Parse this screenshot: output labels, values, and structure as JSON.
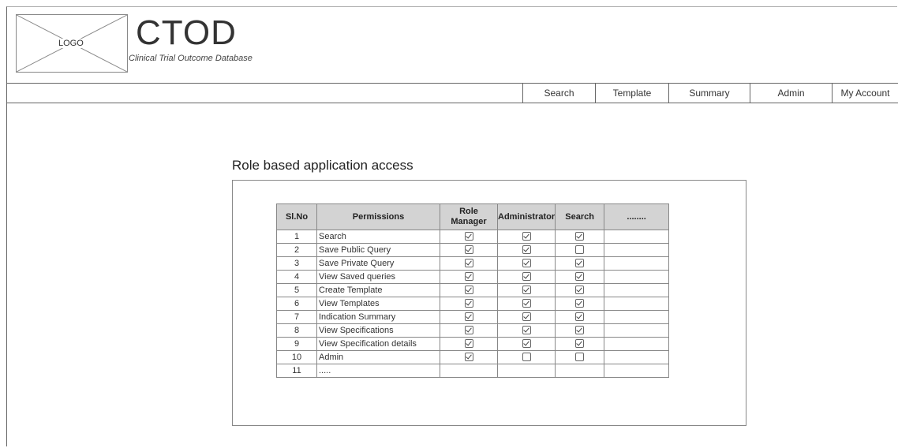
{
  "header": {
    "logo_label": "LOGO",
    "title": "CTOD",
    "subtitle": "Clinical Trial Outcome Database"
  },
  "nav": {
    "items": [
      {
        "label": "Search"
      },
      {
        "label": "Template"
      },
      {
        "label": "Summary"
      },
      {
        "label": "Admin"
      },
      {
        "label": "My Account"
      }
    ]
  },
  "main": {
    "section_title": "Role based application access",
    "table": {
      "headers": {
        "sl_no": "Sl.No",
        "permissions": "Permissions",
        "role_manager": "Role Manager",
        "administrator": "Administrator",
        "search": "Search",
        "more": "........"
      },
      "rows": [
        {
          "no": "1",
          "permission": "Search",
          "role_manager": true,
          "administrator": true,
          "search": true
        },
        {
          "no": "2",
          "permission": "Save Public Query",
          "role_manager": true,
          "administrator": true,
          "search": false
        },
        {
          "no": "3",
          "permission": "Save Private Query",
          "role_manager": true,
          "administrator": true,
          "search": true
        },
        {
          "no": "4",
          "permission": "View Saved queries",
          "role_manager": true,
          "administrator": true,
          "search": true
        },
        {
          "no": "5",
          "permission": "Create Template",
          "role_manager": true,
          "administrator": true,
          "search": true
        },
        {
          "no": "6",
          "permission": "View Templates",
          "role_manager": true,
          "administrator": true,
          "search": true
        },
        {
          "no": "7",
          "permission": "Indication Summary",
          "role_manager": true,
          "administrator": true,
          "search": true
        },
        {
          "no": "8",
          "permission": "View Specifications",
          "role_manager": true,
          "administrator": true,
          "search": true
        },
        {
          "no": "9",
          "permission": "View Specification details",
          "role_manager": true,
          "administrator": true,
          "search": true
        },
        {
          "no": "10",
          "permission": "Admin",
          "role_manager": true,
          "administrator": false,
          "search": false
        },
        {
          "no": "11",
          "permission": ".....",
          "role_manager": null,
          "administrator": null,
          "search": null
        }
      ]
    }
  }
}
